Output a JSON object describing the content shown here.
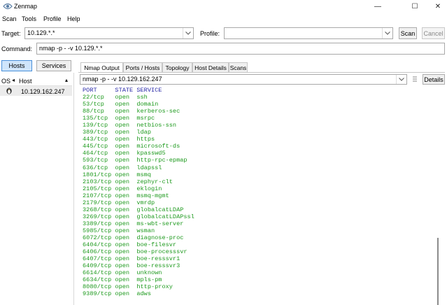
{
  "window": {
    "title": "Zenmap",
    "minimize": "—",
    "maximize": "☐",
    "close": "✕"
  },
  "menu": [
    "Scan",
    "Tools",
    "Profile",
    "Help"
  ],
  "toolbar": {
    "target_label": "Target:",
    "target_value": "10.129.*.*",
    "profile_label": "Profile:",
    "profile_value": "",
    "scan_button": "Scan",
    "cancel_button": "Cancel",
    "command_label": "Command:",
    "command_value": "nmap -p - -v 10.129.*.*"
  },
  "left": {
    "hosts_button": "Hosts",
    "services_button": "Services",
    "col_os": "OS",
    "col_host": "Host",
    "hosts": [
      "10.129.162.247"
    ]
  },
  "tabs": [
    "Nmap Output",
    "Ports / Hosts",
    "Topology",
    "Host Details",
    "Scans"
  ],
  "output": {
    "command_select": "nmap -p - -v 10.129.162.247",
    "details_button": "Details",
    "header": "PORT     STATE SERVICE",
    "lines": [
      "22/tcp   open  ssh",
      "53/tcp   open  domain",
      "88/tcp   open  kerberos-sec",
      "135/tcp  open  msrpc",
      "139/tcp  open  netbios-ssn",
      "389/tcp  open  ldap",
      "443/tcp  open  https",
      "445/tcp  open  microsoft-ds",
      "464/tcp  open  kpasswd5",
      "593/tcp  open  http-rpc-epmap",
      "636/tcp  open  ldapssl",
      "1801/tcp open  msmq",
      "2103/tcp open  zephyr-clt",
      "2105/tcp open  eklogin",
      "2107/tcp open  msmq-mgmt",
      "2179/tcp open  vmrdp",
      "3268/tcp open  globalcatLDAP",
      "3269/tcp open  globalcatLDAPssl",
      "3389/tcp open  ms-wbt-server",
      "5985/tcp open  wsman",
      "6072/tcp open  diagnose-proc",
      "6404/tcp open  boe-filesvr",
      "6406/tcp open  boe-processsvr",
      "6407/tcp open  boe-resssvr1",
      "6409/tcp open  boe-resssvr3",
      "6614/tcp open  unknown",
      "6634/tcp open  mpls-pm",
      "8080/tcp open  http-proxy",
      "9389/tcp open  adws"
    ]
  }
}
